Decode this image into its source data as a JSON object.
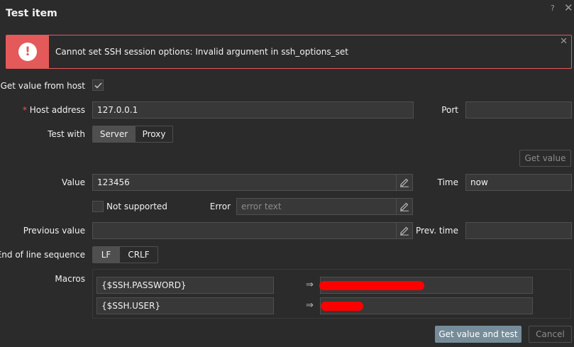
{
  "dialog": {
    "title": "Test item",
    "help": "?",
    "close": "✕"
  },
  "message": {
    "text": "Cannot set SSH session options: Invalid argument in ssh_options_set",
    "icon": "exclamation-icon",
    "color": "#e45959"
  },
  "form": {
    "get_value_from_host": {
      "label": "Get value from host",
      "checked": true
    },
    "host_address": {
      "required_mark": "*",
      "label": "Host address",
      "value": "127.0.0.1"
    },
    "port": {
      "label": "Port",
      "value": ""
    },
    "test_with": {
      "label": "Test with",
      "options": [
        "Server",
        "Proxy"
      ],
      "selected": "Server"
    },
    "get_value_button": "Get value",
    "value": {
      "label": "Value",
      "value": "123456"
    },
    "time": {
      "label": "Time",
      "value": "now"
    },
    "not_supported": {
      "label": "Not supported",
      "checked": false
    },
    "error": {
      "label": "Error",
      "placeholder": "error text"
    },
    "previous_value": {
      "label": "Previous value",
      "value": ""
    },
    "prev_time": {
      "label": "Prev. time",
      "value": ""
    },
    "eol": {
      "label": "End of line sequence",
      "options": [
        "LF",
        "CRLF"
      ],
      "selected": "LF"
    },
    "macros": {
      "label": "Macros",
      "arrow": "⇒",
      "rows": [
        {
          "name": "{$SSH.PASSWORD}",
          "value_redacted": true
        },
        {
          "name": "{$SSH.USER}",
          "value_redacted": true
        }
      ]
    }
  },
  "footer": {
    "submit": "Get value and test",
    "cancel": "Cancel"
  },
  "colors": {
    "background": "#2b2b2b",
    "field": "#383838",
    "border": "#4f4f4f",
    "primary": "#768d99",
    "error": "#e45959"
  }
}
